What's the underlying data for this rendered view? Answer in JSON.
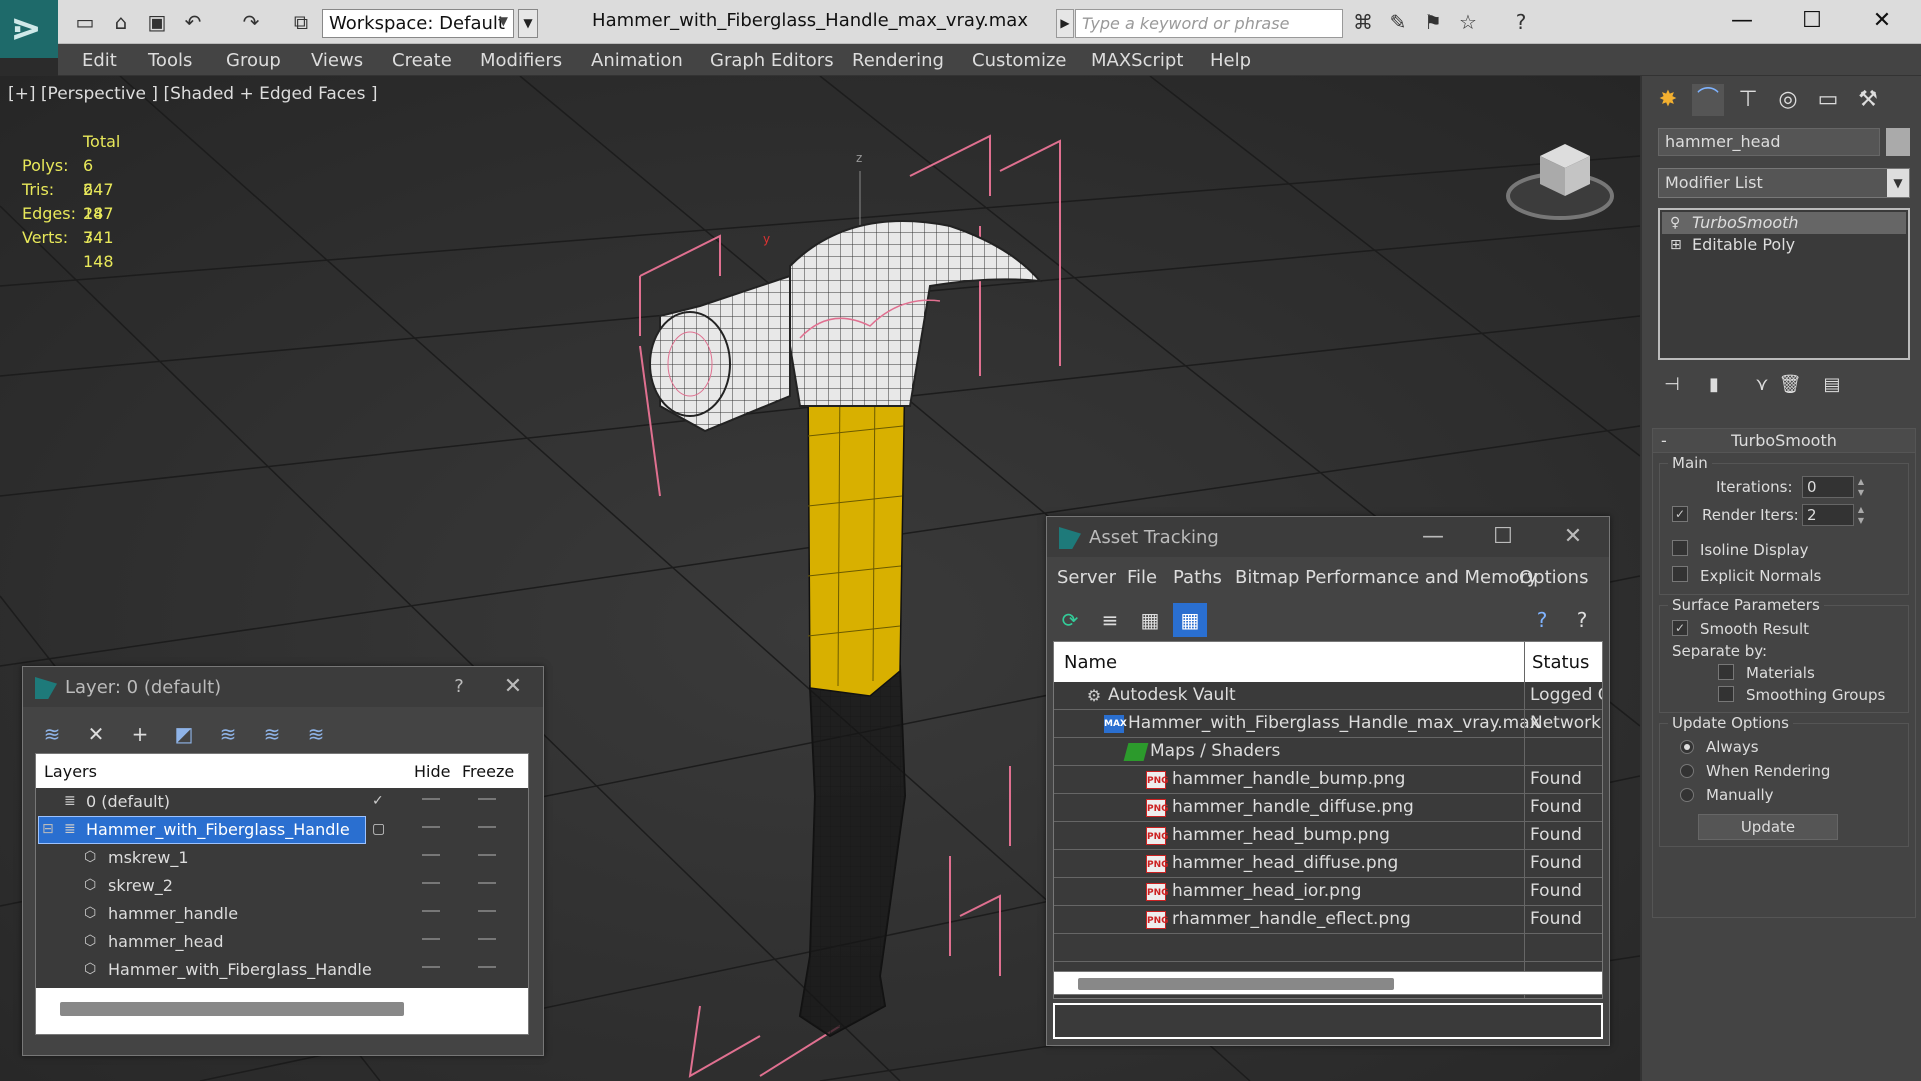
{
  "titlebar": {
    "workspace": "Workspace: Default",
    "document_title": "Hammer_with_Fiberglass_Handle_max_vray.max",
    "search_placeholder": "Type a keyword or phrase",
    "quick_access_icons": [
      "new-file-icon",
      "open-file-icon",
      "save-icon",
      "undo-icon",
      "redo-icon",
      "project-icon"
    ],
    "search_tools_icons": [
      "binoculars-icon",
      "wrench-icon",
      "sign-in-icon",
      "star-icon",
      "help-icon"
    ]
  },
  "menu": [
    "Edit",
    "Tools",
    "Group",
    "Views",
    "Create",
    "Modifiers",
    "Animation",
    "Graph Editors",
    "Rendering",
    "Customize",
    "MAXScript",
    "Help"
  ],
  "viewport": {
    "label": "[+] [Perspective ] [Shaded + Edged Faces ]",
    "stats": {
      "header": "Total",
      "rows": [
        {
          "k": "Polys:",
          "v": "6 247"
        },
        {
          "k": "Tris:",
          "v": "6 247"
        },
        {
          "k": "Edges:",
          "v": "18 741"
        },
        {
          "k": "Verts:",
          "v": "3 148"
        }
      ]
    },
    "axis_z": "z",
    "axis_y": "y"
  },
  "command_panel": {
    "tabs": [
      "create-icon",
      "modify-icon",
      "hierarchy-icon",
      "motion-icon",
      "display-icon",
      "utilities-icon"
    ],
    "object_name": "hammer_head",
    "modifier_list": "Modifier List",
    "stack": [
      "TurboSmooth",
      "Editable Poly"
    ],
    "rollout_title": "TurboSmooth",
    "main": {
      "title": "Main",
      "iterations_label": "Iterations:",
      "iterations_value": "0",
      "render_iters_label": "Render Iters:",
      "render_iters_value": "2",
      "isoline": "Isoline Display",
      "explicit": "Explicit Normals"
    },
    "surface": {
      "title": "Surface Parameters",
      "smooth": "Smooth Result",
      "separate_by": "Separate by:",
      "materials": "Materials",
      "smoothing_groups": "Smoothing Groups"
    },
    "update": {
      "title": "Update Options",
      "always": "Always",
      "when_rendering": "When Rendering",
      "manually": "Manually",
      "button": "Update"
    }
  },
  "layer_dialog": {
    "title": "Layer: 0 (default)",
    "help": "?",
    "columns": {
      "layers": "Layers",
      "hide": "Hide",
      "freeze": "Freeze"
    },
    "rows": [
      {
        "name": "0 (default)",
        "indent": 0
      },
      {
        "name": "Hammer_with_Fiberglass_Handle",
        "indent": 0
      },
      {
        "name": "mskrew_1",
        "indent": 1
      },
      {
        "name": "skrew_2",
        "indent": 1
      },
      {
        "name": "hammer_handle",
        "indent": 1
      },
      {
        "name": "hammer_head",
        "indent": 1
      },
      {
        "name": "Hammer_with_Fiberglass_Handle",
        "indent": 1
      }
    ]
  },
  "asset_dialog": {
    "title": "Asset Tracking",
    "menu": [
      "Server",
      "File",
      "Paths",
      "Bitmap Performance and Memory",
      "Options"
    ],
    "columns": {
      "name": "Name",
      "status": "Status"
    },
    "rows": [
      {
        "name": "Autodesk Vault",
        "status": "Logged C",
        "icon": "vault"
      },
      {
        "name": "Hammer_with_Fiberglass_Handle_max_vray.max",
        "status": "Network",
        "icon": "max"
      },
      {
        "name": "Maps / Shaders",
        "status": "",
        "icon": "maps"
      },
      {
        "name": "hammer_handle_bump.png",
        "status": "Found",
        "icon": "png"
      },
      {
        "name": "hammer_handle_diffuse.png",
        "status": "Found",
        "icon": "png"
      },
      {
        "name": "hammer_head_bump.png",
        "status": "Found",
        "icon": "png"
      },
      {
        "name": "hammer_head_diffuse.png",
        "status": "Found",
        "icon": "png"
      },
      {
        "name": "hammer_head_ior.png",
        "status": "Found",
        "icon": "png"
      },
      {
        "name": "rhammer_handle_eflect.png",
        "status": "Found",
        "icon": "png"
      }
    ],
    "icon_labels": {
      "png": "PNG",
      "max": "MAX"
    }
  },
  "colors": {
    "accent": "#2a6fd0",
    "stats_yellow": "#e8e85a",
    "handle_yellow": "#d8b000"
  }
}
